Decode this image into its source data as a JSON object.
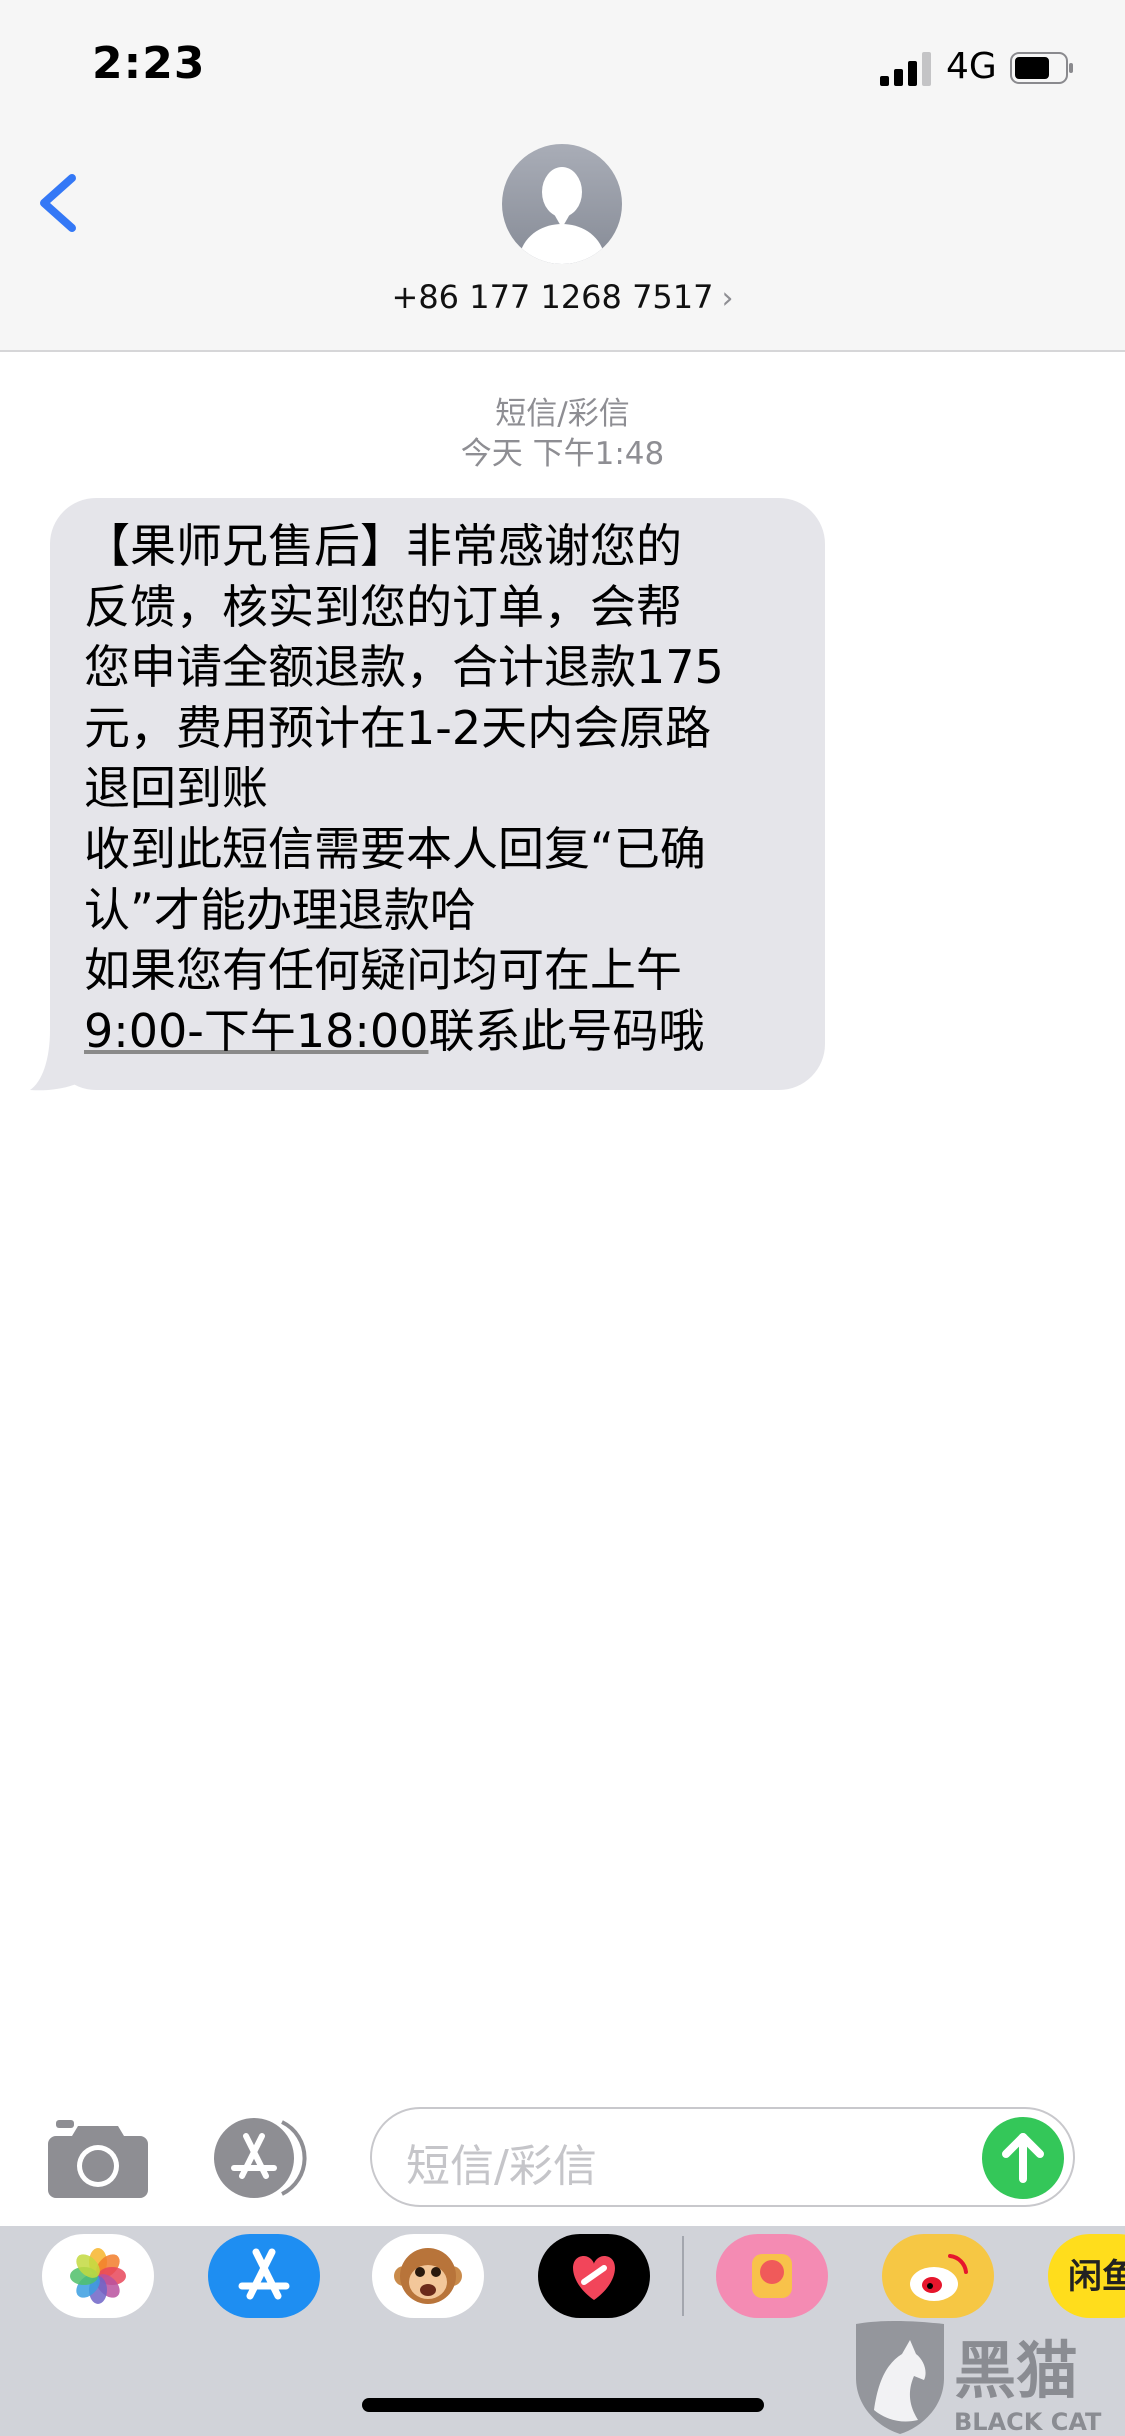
{
  "status_bar": {
    "time": "2:23",
    "network": "4G",
    "signal_icon": "cellular-signal-icon",
    "battery_icon": "battery-icon"
  },
  "header": {
    "contact": "+86 177 1268 7517",
    "back_icon": "chevron-left-icon",
    "avatar_icon": "person-silhouette-icon",
    "contact_chevron": "›"
  },
  "conversation": {
    "type_label": "短信/彩信",
    "timestamp": "今天 下午1:48",
    "message": {
      "line1": "【果师兄售后】非常感谢您的",
      "line2": "反馈，核实到您的订单，会帮",
      "line3": "您申请全额退款，合计退款175",
      "line4": "元，费用预计在1-2天内会原路",
      "line5": "退回到账",
      "line6": "收到此短信需要本人回复“已确",
      "line7": "认”才能办理退款哈",
      "line8": "如果您有任何疑问均可在上午",
      "line9_link": "9:00-下午18:00",
      "line9_rest": "联系此号码哦"
    }
  },
  "input_bar": {
    "placeholder": "短信/彩信",
    "camera_icon": "camera-icon",
    "appstore_icon": "app-store-icon",
    "send_icon": "arrow-up-icon"
  },
  "app_drawer": {
    "apps": [
      "photos-icon",
      "app-store-icon",
      "animoji-icon",
      "digital-touch-icon",
      "meitu-icon",
      "weibo-icon",
      "xianyu-icon"
    ],
    "partial_label": "闲鱼"
  },
  "watermark": {
    "text_cn": "黑猫",
    "text_en": "BLACK CAT"
  },
  "colors": {
    "accent": "#3478f6",
    "bubble": "#e5e5ea",
    "send": "#34c759",
    "bar_bg": "#f6f6f6",
    "drawer_bg": "#d1d3d9"
  }
}
